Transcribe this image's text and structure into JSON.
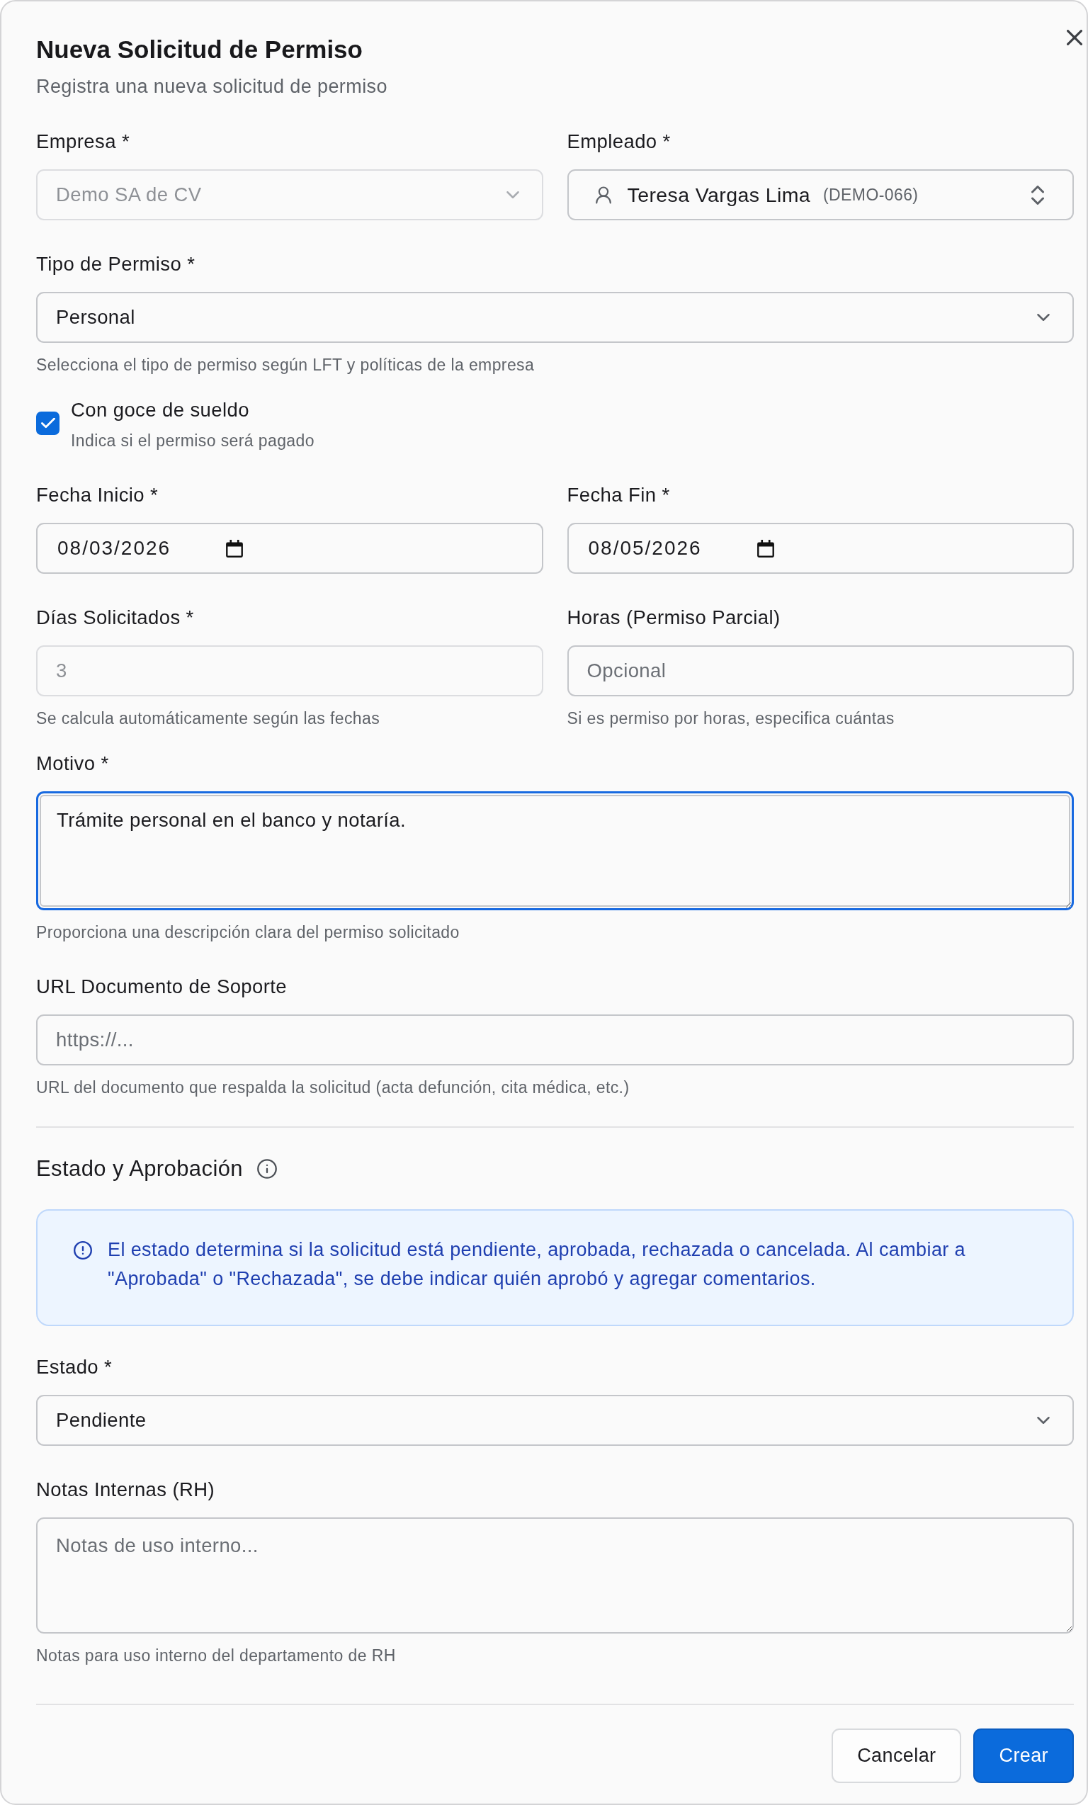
{
  "dialog": {
    "title": "Nueva Solicitud de Permiso",
    "subtitle": "Registra una nueva solicitud de permiso"
  },
  "sections": [
    {
      "rows": [
        [
          {
            "kind": "select",
            "label": "Empresa *",
            "value": "Demo SA de CV",
            "disabled": true,
            "focused": false
          },
          {
            "kind": "combobox",
            "label": "Empleado *",
            "value": "Teresa Vargas Lima",
            "code": "(DEMO-066)",
            "disabled": false,
            "focused": false
          }
        ],
        [
          {
            "kind": "select",
            "label": "Tipo de Permiso *",
            "value": "Personal",
            "help": "Selecciona el tipo de permiso según LFT y políticas de la empresa",
            "disabled": false,
            "focused": false
          }
        ],
        [
          {
            "kind": "checkbox",
            "label": "Con goce de sueldo",
            "help": "Indica si el permiso será pagado",
            "checked": true
          }
        ],
        [
          {
            "kind": "date",
            "label": "Fecha Inicio *",
            "value": "08/03/2026",
            "disabled": false,
            "focused": false
          },
          {
            "kind": "date",
            "label": "Fecha Fin *",
            "value": "08/05/2026",
            "disabled": false,
            "focused": false
          }
        ],
        [
          {
            "kind": "input",
            "label": "Días Solicitados *",
            "value": "3",
            "help": "Se calcula automáticamente según las fechas",
            "disabled": true,
            "focused": false
          },
          {
            "kind": "input",
            "label": "Horas (Permiso Parcial)",
            "placeholder": "Opcional",
            "help": "Si es permiso por horas, especifica cuántas",
            "disabled": false,
            "focused": false
          }
        ],
        [
          {
            "kind": "textarea",
            "label": "Motivo *",
            "value": "Trámite personal en el banco y notaría.",
            "help": "Proporciona una descripción clara del permiso solicitado",
            "disabled": false,
            "focused": true
          }
        ],
        [
          {
            "kind": "input",
            "label": "URL Documento de Soporte",
            "placeholder": "https://...",
            "help": "URL del documento que respalda la solicitud (acta defunción, cita médica, etc.)",
            "disabled": false,
            "focused": false
          }
        ]
      ]
    },
    {
      "heading": "Estado y Aprobación",
      "alert": "El estado determina si la solicitud está pendiente, aprobada, rechazada o cancelada. Al cambiar a \"Aprobada\" o \"Rechazada\", se debe indicar quién aprobó y agregar comentarios.",
      "rows": [
        [
          {
            "kind": "select",
            "label": "Estado *",
            "value": "Pendiente",
            "disabled": false,
            "focused": false
          }
        ],
        [
          {
            "kind": "textarea",
            "label": "Notas Internas (RH)",
            "placeholder": "Notas de uso interno...",
            "help": "Notas para uso interno del departamento de RH",
            "disabled": false,
            "focused": false
          }
        ]
      ]
    }
  ],
  "buttons": [
    {
      "label": "Cancelar",
      "kind": "secondary"
    },
    {
      "label": "Crear",
      "kind": "primary"
    }
  ]
}
